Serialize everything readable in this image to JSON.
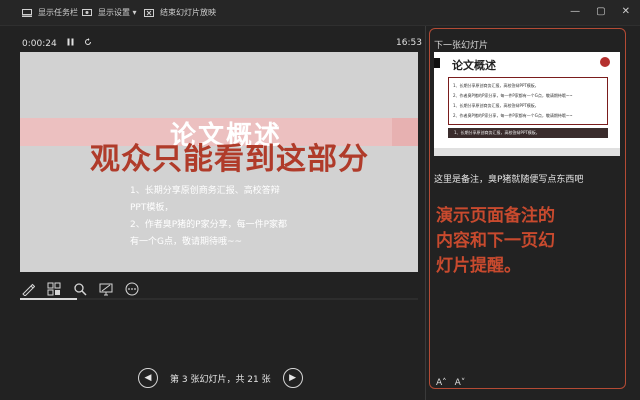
{
  "toolbar": {
    "show_taskbar": "显示任务栏",
    "display_settings": "显示设置 ▾",
    "end_show": "结束幻灯片放映",
    "window_controls": [
      "—",
      "▢",
      "✕"
    ]
  },
  "presenter": {
    "elapsed": "0:00:24",
    "clock": "16:53",
    "pause_icon": "pause-icon",
    "reset_icon": "reset-icon"
  },
  "slide": {
    "title": "论文概述",
    "bullets": [
      "1、长期分享原创商务汇报、高校答辩",
      "PPT模板，",
      "2、作者臭P猪的P家分享，每一件P家都",
      "有一个G点，敬请期待哦~~"
    ],
    "overlay_caption": "观众只能看到这部分"
  },
  "tools": {
    "items": [
      "pen-icon",
      "grid-icon",
      "zoom-icon",
      "screen-icon",
      "more-icon"
    ]
  },
  "progress": {
    "current_slide": 3,
    "total_slides": 21
  },
  "navigation": {
    "prev": "◀",
    "next": "▶",
    "label": "第 3 张幻灯片，共 21 张"
  },
  "next_slide": {
    "header": "下一张幻灯片",
    "title": "论文概述",
    "lines": [
      "1、长期分享原创商务汇报，高校答辩PPT模板，",
      "2、作者臭P猪的P家分享，每一件P家都有一个G点，敬请期待哦~~",
      "1、长期分享原创商务汇报，高校答辩PPT模板，",
      "2、作者臭P猪的P家分享，每一件P家都有一个G点，敬请期待哦~~"
    ],
    "dark_line": "1、长期分享原创商务汇报，高校答辩PPT模板，"
  },
  "notes": {
    "text": "这里是备注，臭P猪就随便写点东西吧"
  },
  "callout": {
    "lines": [
      "演示页面备注的",
      "内容和下一页幻",
      "灯片提醒。"
    ]
  },
  "font_controls": {
    "increase": "A˄",
    "decrease": "A˅"
  },
  "colors": {
    "accent_red": "#c84a2e",
    "band_pink": "#ecc0c0",
    "background": "#222222"
  }
}
